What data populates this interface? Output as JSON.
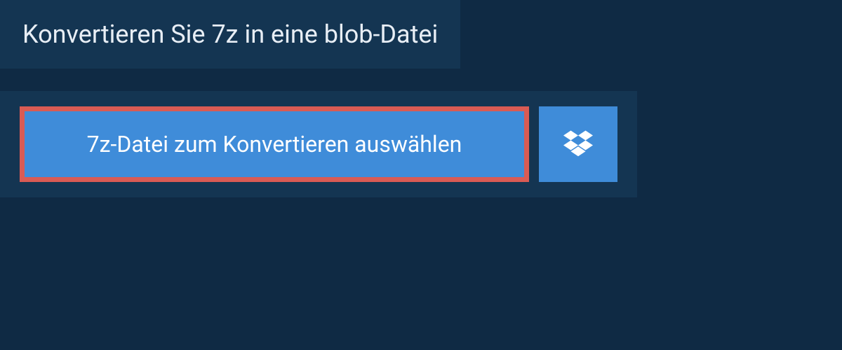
{
  "header": {
    "title": "Konvertieren Sie 7z in eine blob-Datei"
  },
  "upload": {
    "choose_label": "7z-Datei zum Konvertieren auswählen"
  }
}
